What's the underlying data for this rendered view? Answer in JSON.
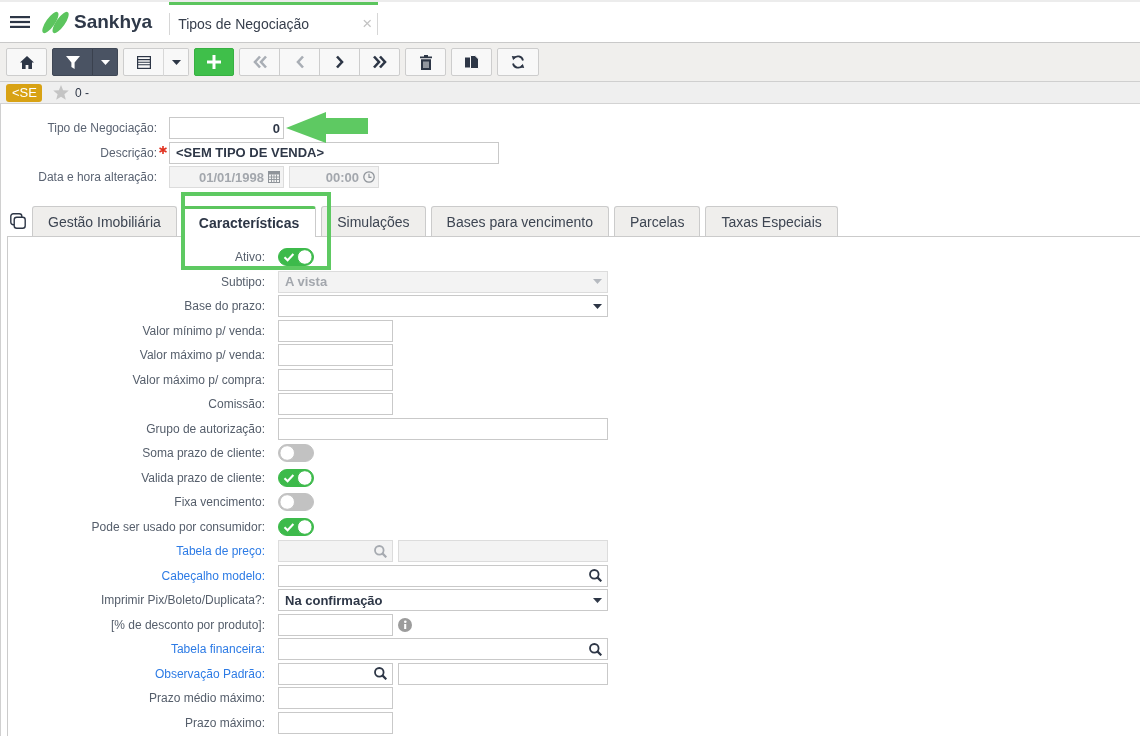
{
  "header": {
    "app_name": "Sankhya",
    "open_tab": {
      "title": "Tipos de Negociação",
      "close": "×"
    }
  },
  "toolbar": {
    "filter_active": true,
    "navigation": [
      {
        "kind": "first",
        "disabled": true
      },
      {
        "kind": "previous",
        "disabled": true
      },
      {
        "kind": "next",
        "disabled": false
      },
      {
        "kind": "last",
        "disabled": false
      }
    ]
  },
  "record_bar": {
    "badge": "<SE",
    "favorite": false,
    "title": "0 -"
  },
  "form": {
    "fields": [
      {
        "kind": "number",
        "label": "Tipo de Negociação:",
        "value": "0",
        "required": false,
        "disabled": false,
        "callout": {
          "kind": "arrow"
        }
      },
      {
        "kind": "text",
        "label": "Descrição:",
        "value": "<SEM TIPO DE VENDA>",
        "required": true,
        "disabled": false
      },
      {
        "kind": "datetime",
        "label": "Data e hora alteração:",
        "date": "01/01/1998",
        "time": "00:00",
        "required": false,
        "disabled": true
      }
    ]
  },
  "tabs": [
    {
      "label": "Gestão Imobiliária",
      "selected": false
    },
    {
      "label": "Características",
      "selected": true,
      "callout": {
        "kind": "frame"
      }
    },
    {
      "label": "Simulações",
      "selected": false
    },
    {
      "label": "Bases para vencimento",
      "selected": false
    },
    {
      "label": "Parcelas",
      "selected": false
    },
    {
      "label": "Taxas Especiais",
      "selected": false
    }
  ],
  "tab_content": {
    "fields": [
      {
        "kind": "toggle",
        "label": "Ativo:",
        "on": true,
        "link": false,
        "disabled": false,
        "info": false
      },
      {
        "kind": "select",
        "label": "Subtipo:",
        "value": "A vista",
        "link": false,
        "disabled": true,
        "info": false
      },
      {
        "kind": "select",
        "label": "Base do prazo:",
        "link": false,
        "disabled": false,
        "info": false
      },
      {
        "kind": "number",
        "label": "Valor mínimo p/ venda:",
        "link": false,
        "disabled": false,
        "info": false
      },
      {
        "kind": "number",
        "label": "Valor máximo p/ venda:",
        "link": false,
        "disabled": false,
        "info": false
      },
      {
        "kind": "number",
        "label": "Valor máximo p/ compra:",
        "link": false,
        "disabled": false,
        "info": false
      },
      {
        "kind": "number",
        "label": "Comissão:",
        "link": false,
        "disabled": false,
        "info": false
      },
      {
        "kind": "text",
        "label": "Grupo de autorização:",
        "link": false,
        "disabled": false,
        "info": false
      },
      {
        "kind": "toggle",
        "label": "Soma prazo de cliente:",
        "on": false,
        "link": false,
        "disabled": false,
        "info": false
      },
      {
        "kind": "toggle",
        "label": "Valida prazo de cliente:",
        "on": true,
        "link": false,
        "disabled": false,
        "info": false
      },
      {
        "kind": "toggle",
        "label": "Fixa vencimento:",
        "on": false,
        "link": false,
        "disabled": false,
        "info": false
      },
      {
        "kind": "toggle",
        "label": "Pode ser usado por consumidor:",
        "on": true,
        "link": false,
        "disabled": false,
        "info": false
      },
      {
        "kind": "lookup_pair",
        "label": "Tabela de preço:",
        "link": true,
        "disabled": true,
        "info": false
      },
      {
        "kind": "lookup",
        "label": "Cabeçalho modelo:",
        "link": true,
        "disabled": false,
        "info": false
      },
      {
        "kind": "select",
        "label": "Imprimir Pix/Boleto/Duplicata?:",
        "value": "Na confirmação",
        "link": false,
        "disabled": false,
        "info": false
      },
      {
        "kind": "number",
        "label": "[% de desconto por produto]:",
        "link": false,
        "disabled": false,
        "info": true
      },
      {
        "kind": "lookup",
        "label": "Tabela financeira:",
        "link": true,
        "disabled": false,
        "info": false
      },
      {
        "kind": "lookup_pair",
        "label": "Observação Padrão:",
        "link": true,
        "disabled": false,
        "info": false
      },
      {
        "kind": "number",
        "label": "Prazo médio máximo:",
        "link": false,
        "disabled": false,
        "info": false
      },
      {
        "kind": "number",
        "label": "Prazo máximo:",
        "link": false,
        "disabled": false,
        "info": false
      }
    ]
  }
}
